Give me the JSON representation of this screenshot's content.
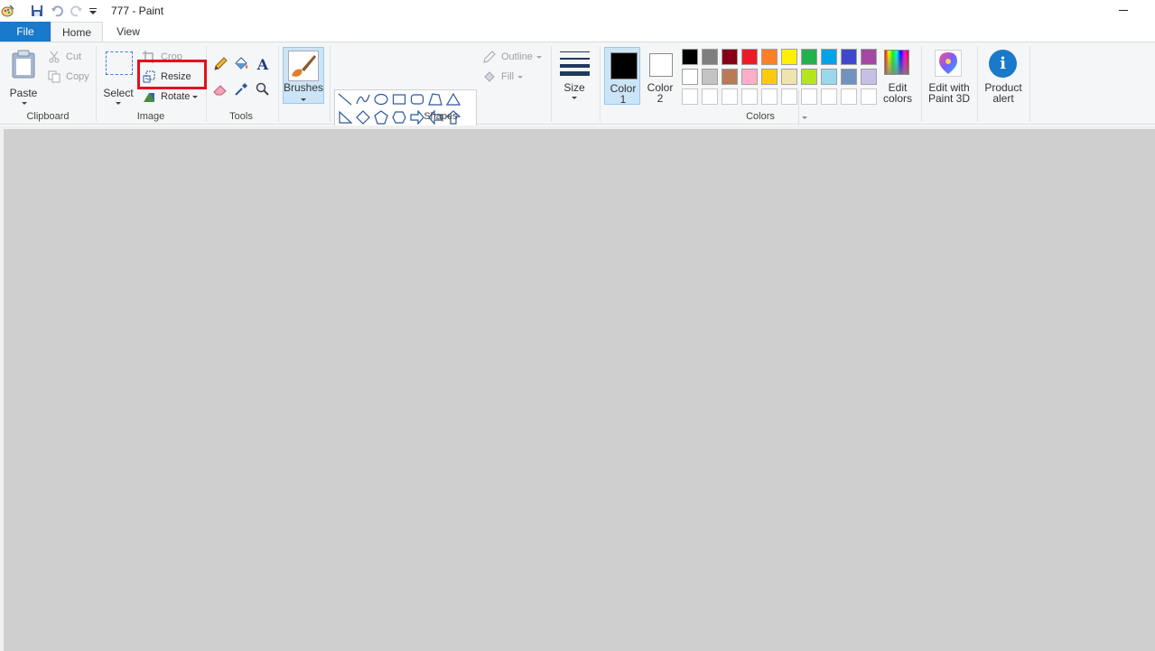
{
  "window": {
    "title": "777 - Paint"
  },
  "tabs": [
    {
      "label": "File"
    },
    {
      "label": "Home"
    },
    {
      "label": "View"
    }
  ],
  "clipboard": {
    "group_label": "Clipboard",
    "paste_label": "Paste",
    "cut_label": "Cut",
    "copy_label": "Copy"
  },
  "image": {
    "group_label": "Image",
    "select_label": "Select",
    "crop_label": "Crop",
    "resize_label": "Resize",
    "rotate_label": "Rotate"
  },
  "tools": {
    "group_label": "Tools"
  },
  "brushes": {
    "label": "Brushes"
  },
  "shapes": {
    "group_label": "Shapes",
    "outline_label": "Outline",
    "fill_label": "Fill"
  },
  "size": {
    "label": "Size"
  },
  "colors": {
    "group_label": "Colors",
    "color1_label_line1": "Color",
    "color1_label_line2": "1",
    "color2_label_line1": "Color",
    "color2_label_line2": "2",
    "color1_value": "#000000",
    "color2_value": "#ffffff",
    "edit_colors_line1": "Edit",
    "edit_colors_line2": "colors",
    "palette_row1": [
      "#000000",
      "#7f7f7f",
      "#880015",
      "#ed1c24",
      "#ff7f27",
      "#fff200",
      "#22b14c",
      "#00a2e8",
      "#3f48cc",
      "#a349a4"
    ],
    "palette_row2": [
      "#ffffff",
      "#c3c3c3",
      "#b97a57",
      "#ffaec9",
      "#ffc90e",
      "#efe4b0",
      "#b5e61d",
      "#99d9ea",
      "#7092be",
      "#c8bfe7"
    ],
    "palette_row3": [
      "#ffffff",
      "#ffffff",
      "#ffffff",
      "#ffffff",
      "#ffffff",
      "#ffffff",
      "#ffffff",
      "#ffffff",
      "#ffffff",
      "#ffffff"
    ]
  },
  "paint3d": {
    "label_line1": "Edit with",
    "label_line2": "Paint 3D"
  },
  "product_alert": {
    "label_line1": "Product",
    "label_line2": "alert"
  },
  "accent_color": "#1979ca",
  "highlight_color": "#e3101e"
}
